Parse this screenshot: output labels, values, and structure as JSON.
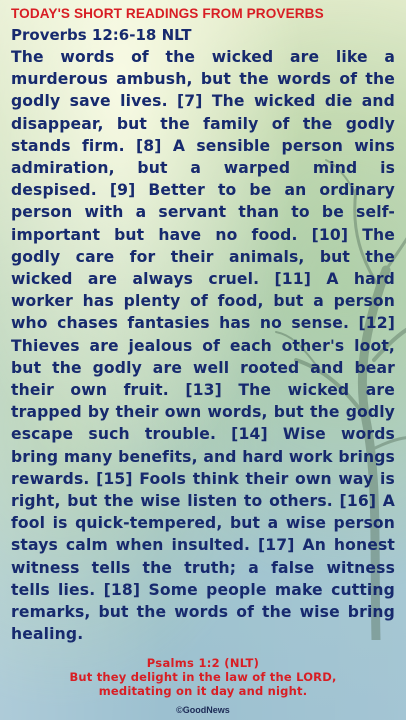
{
  "header": {
    "title": "TODAY'S SHORT READINGS FROM PROVERBS"
  },
  "reading": {
    "reference": "Proverbs 12:6-18 NLT",
    "text": "The words of the wicked are like a murderous ambush, but the words of the godly save lives. [7] The wicked die and disappear, but the family of the godly stands firm. [8] A sensible person wins admiration, but a warped mind is despised. [9] Better to be an ordinary person with a servant than to be self-important but have no food. [10] The godly care for their animals, but the wicked are always cruel. [11] A hard worker has plenty of food, but a person who chases fantasies has no sense. [12] Thieves are jealous of each other's loot, but the godly are well rooted and bear their own fruit. [13] The wicked are trapped by their own words, but the godly escape such trouble. [14] Wise words bring many benefits, and hard work brings rewards. [15] Fools think their own way is right, but the wise listen to others. [16] A fool is quick-tempered, but a wise person stays calm when insulted. [17] An honest witness tells the truth; a false witness tells lies. [18] Some people make cutting remarks, but the words of the wise bring healing."
  },
  "footer": {
    "reference": "Psalms 1:2 (NLT)",
    "quote_line1": "But they delight in the law of the LORD,",
    "quote_line2": "meditating on it day and night.",
    "copyright": "©GoodNews"
  },
  "colors": {
    "heading_red": "#d81e24",
    "body_navy": "#172a6e"
  }
}
